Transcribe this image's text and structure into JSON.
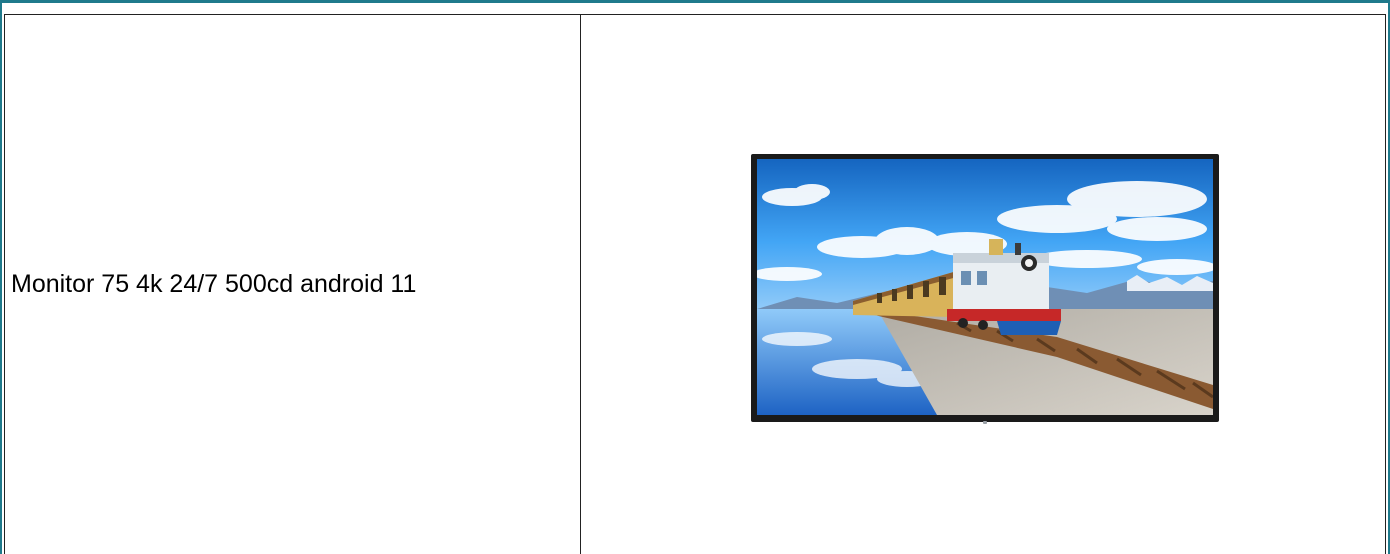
{
  "product": {
    "name": "Monitor 75 4k 24/7 500cd android 11"
  },
  "image": {
    "subject": "display-monitor-icon"
  },
  "colors": {
    "frame_accent": "#1f7a8c",
    "table_border": "#222222",
    "monitor_bezel": "#1a1a1a"
  }
}
